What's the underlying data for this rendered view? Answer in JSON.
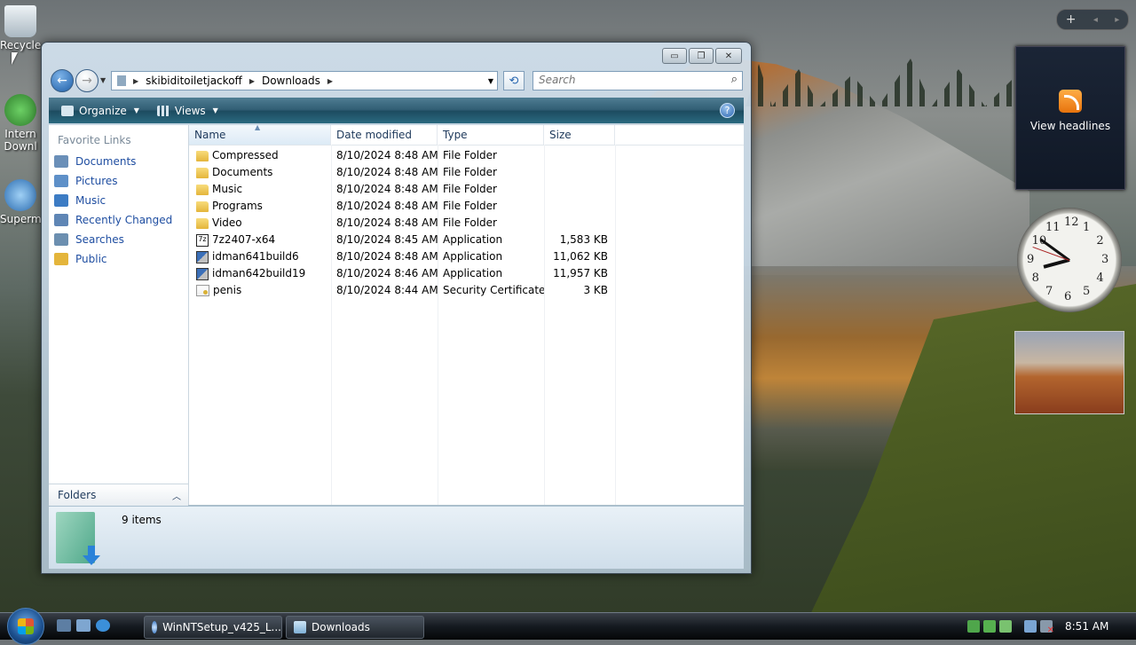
{
  "desktop": {
    "icons": [
      {
        "label": "Recycle",
        "color": "#c9d3da"
      },
      {
        "label": "Intern",
        "label2": "Downl",
        "color": "#3f9b3a"
      },
      {
        "label": "Superm",
        "color": "#2a6bb0"
      }
    ]
  },
  "sidebar": {
    "feed_label": "View headlines",
    "clock_numbers": [
      "12",
      "1",
      "2",
      "3",
      "4",
      "5",
      "6",
      "7",
      "8",
      "9",
      "10",
      "11"
    ]
  },
  "window": {
    "title_buttons": {
      "minimize": "▭",
      "maximize": "❐",
      "close": "✕"
    },
    "address": {
      "segments": [
        "skibiditoiletjackoff",
        "Downloads"
      ]
    },
    "search": {
      "placeholder": "Search"
    },
    "toolbar": {
      "organize": "Organize",
      "views": "Views",
      "help": "?"
    },
    "nav_pane": {
      "title": "Favorite Links",
      "items": [
        {
          "label": "Documents",
          "color": "#6a8fb8"
        },
        {
          "label": "Pictures",
          "color": "#5e90c8"
        },
        {
          "label": "Music",
          "color": "#3d7cc4"
        },
        {
          "label": "Recently Changed",
          "color": "#5f86b5"
        },
        {
          "label": "Searches",
          "color": "#6c8fb0"
        },
        {
          "label": "Public",
          "color": "#e4b53b"
        }
      ],
      "folders_label": "Folders"
    },
    "columns": [
      "Name",
      "Date modified",
      "Type",
      "Size"
    ],
    "files": [
      {
        "name": "Compressed",
        "date": "8/10/2024 8:48 AM",
        "type": "File Folder",
        "size": "",
        "icon": "folder"
      },
      {
        "name": "Documents",
        "date": "8/10/2024 8:48 AM",
        "type": "File Folder",
        "size": "",
        "icon": "folder"
      },
      {
        "name": "Music",
        "date": "8/10/2024 8:48 AM",
        "type": "File Folder",
        "size": "",
        "icon": "folder"
      },
      {
        "name": "Programs",
        "date": "8/10/2024 8:48 AM",
        "type": "File Folder",
        "size": "",
        "icon": "folder"
      },
      {
        "name": "Video",
        "date": "8/10/2024 8:48 AM",
        "type": "File Folder",
        "size": "",
        "icon": "folder"
      },
      {
        "name": "7z2407-x64",
        "date": "8/10/2024 8:45 AM",
        "type": "Application",
        "size": "1,583 KB",
        "icon": "seven"
      },
      {
        "name": "idman641build6",
        "date": "8/10/2024 8:48 AM",
        "type": "Application",
        "size": "11,062 KB",
        "icon": "app"
      },
      {
        "name": "idman642build19",
        "date": "8/10/2024 8:46 AM",
        "type": "Application",
        "size": "11,957 KB",
        "icon": "app"
      },
      {
        "name": "penis",
        "date": "8/10/2024 8:44 AM",
        "type": "Security Certificate",
        "size": "3 KB",
        "icon": "cert"
      }
    ],
    "status": {
      "count": "9 items"
    }
  },
  "taskbar": {
    "tasks": [
      {
        "label": "WinNTSetup_v425_L...",
        "color": "#5a8fd0"
      },
      {
        "label": "Downloads",
        "color": "#8fc0e6"
      }
    ],
    "time": "8:51 AM"
  }
}
